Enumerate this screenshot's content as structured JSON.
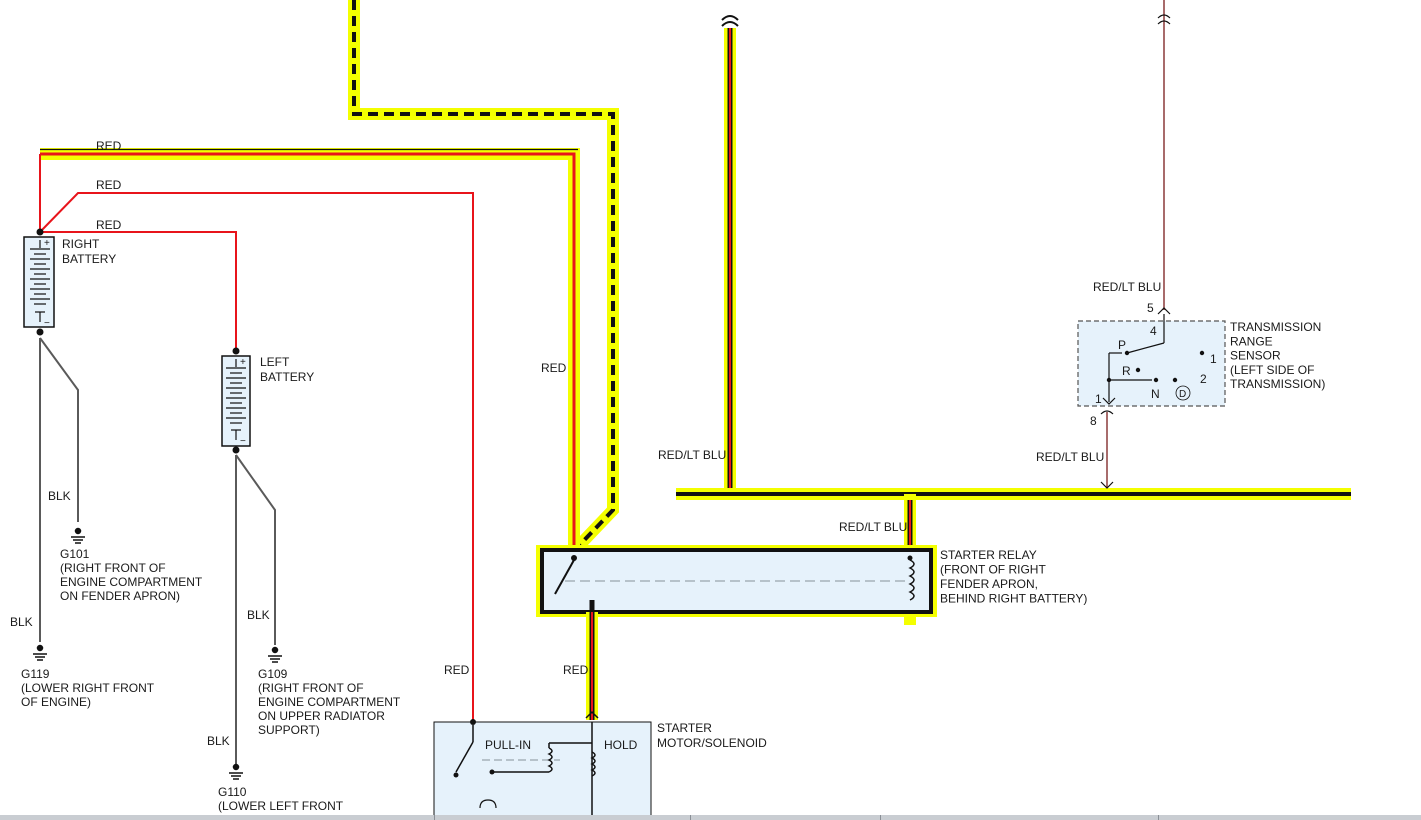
{
  "wire_labels": {
    "red_top": "RED",
    "red_middle": "RED",
    "red_lower": "RED",
    "red_relay_feed": "RED",
    "red_pullin": "RED",
    "red_hold": "RED",
    "blk_g101": "BLK",
    "blk_g119": "BLK",
    "blk_g109": "BLK",
    "blk_g110": "BLK",
    "redltblu_left": "RED/LT BLU",
    "redltblu_relay": "RED/LT BLU",
    "redltblu_right": "RED/LT BLU",
    "redltblu_top": "RED/LT BLU"
  },
  "components": {
    "right_battery": [
      "RIGHT",
      "BATTERY"
    ],
    "left_battery": [
      "LEFT",
      "BATTERY"
    ],
    "starter_relay": [
      "STARTER RELAY",
      "(FRONT OF RIGHT",
      "FENDER APRON,",
      "BEHIND RIGHT BATTERY)"
    ],
    "starter_motor": [
      "STARTER",
      "MOTOR/SOLENOID"
    ],
    "pull_in": "PULL-IN",
    "hold": "HOLD",
    "trs": [
      "TRANSMISSION",
      "RANGE",
      "SENSOR",
      "(LEFT SIDE OF",
      "TRANSMISSION)"
    ]
  },
  "grounds": {
    "g101": [
      "G101",
      "(RIGHT FRONT OF",
      "ENGINE COMPARTMENT",
      "ON FENDER APRON)"
    ],
    "g119": [
      "G119",
      "(LOWER RIGHT FRONT",
      "OF ENGINE)"
    ],
    "g109": [
      "G109",
      "(RIGHT FRONT OF",
      "ENGINE COMPARTMENT",
      "ON UPPER RADIATOR",
      "SUPPORT)"
    ],
    "g110": [
      "G110",
      "(LOWER LEFT FRONT"
    ]
  },
  "pins": {
    "pin_5": "5",
    "pin_4": "4",
    "pin_1": "1",
    "pin_8": "8"
  },
  "trs_positions": {
    "p": "P",
    "r": "R",
    "n": "N",
    "d": "D",
    "one": "1",
    "two": "2"
  },
  "battery_terminals": {
    "plus": "+",
    "minus": "−"
  },
  "colors": {
    "red_wire": "#e8141b",
    "black_wire": "#111111",
    "highlight": "#f4ff00",
    "ground_wire": "#5a5a5a",
    "brown_wire": "#8b3a3a",
    "component_fill": "#e6f2fb"
  }
}
